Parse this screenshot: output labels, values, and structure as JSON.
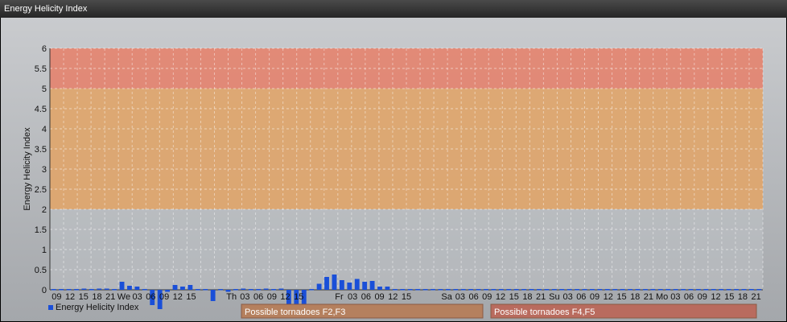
{
  "window": {
    "title": "Energy Helicity Index"
  },
  "chart_data": {
    "type": "bar",
    "ylabel": "Energy Helicity Index",
    "ylim": [
      0,
      6
    ],
    "yticks": [
      0,
      0.5,
      1,
      1.5,
      2,
      2.5,
      3,
      3.5,
      4,
      4.5,
      5,
      5.5,
      6
    ],
    "grid": true,
    "series": [
      {
        "name": "Energy Helicity Index",
        "color": "#1a4fd8",
        "values": [
          0.02,
          0.02,
          0.02,
          0.02,
          0.03,
          0.02,
          0.03,
          0.03,
          0.02,
          0.2,
          0.1,
          0.08,
          0.02,
          -0.38,
          -0.48,
          -0.05,
          0.12,
          0.08,
          0.12,
          0.02,
          0.02,
          -0.28,
          0.02,
          -0.05,
          0.02,
          0.03,
          0.02,
          0.02,
          0.03,
          0.02,
          0.03,
          -0.45,
          -0.5,
          -0.4,
          0.02,
          0.15,
          0.32,
          0.38,
          0.24,
          0.18,
          0.27,
          0.2,
          0.22,
          0.08,
          0.08,
          0.02,
          0.02,
          0.02,
          0.02,
          0.02,
          0.02,
          0.02,
          0.02,
          0.02,
          0.02,
          0.02,
          0.02,
          0.02,
          0.02,
          0.02,
          0.02,
          0.02,
          0.02,
          0.02,
          0.02,
          0.02,
          0.02,
          0.02,
          0.02,
          0.02,
          0.02,
          0.02,
          0.02,
          0.02,
          0.02,
          0.02,
          0.02,
          0.02,
          0.02,
          0.02,
          0.02,
          0.02,
          0.02,
          0.02,
          0.02,
          0.02,
          0.02,
          0.02,
          0.02,
          0.02,
          0.02,
          0.02,
          0.02,
          0.02
        ]
      }
    ],
    "x_labels": [
      "09",
      "12",
      "15",
      "18",
      "21",
      "We",
      "03",
      "06",
      "09",
      "12",
      "15",
      "",
      "",
      "Th",
      "03",
      "06",
      "09",
      "12",
      "15",
      "",
      "",
      "Fr",
      "03",
      "06",
      "09",
      "12",
      "15",
      "",
      "",
      "Sa",
      "03",
      "06",
      "09",
      "12",
      "15",
      "18",
      "21",
      "Su",
      "03",
      "06",
      "09",
      "12",
      "15",
      "18",
      "21",
      "Mo",
      "03",
      "06",
      "09",
      "12",
      "15",
      "18",
      "21"
    ],
    "bands": [
      {
        "from": 0,
        "to": 2,
        "color": "#bfc2c6"
      },
      {
        "from": 2,
        "to": 5,
        "color": "#e0a56a"
      },
      {
        "from": 5,
        "to": 6,
        "color": "#e4836e"
      }
    ],
    "annotations": [
      {
        "label": "Possible tornadoes F2,F3",
        "color": "#b5805e"
      },
      {
        "label": "Possible tornadoes F4,F5",
        "color": "#b96b5e"
      }
    ],
    "legend": "bottom-left"
  }
}
